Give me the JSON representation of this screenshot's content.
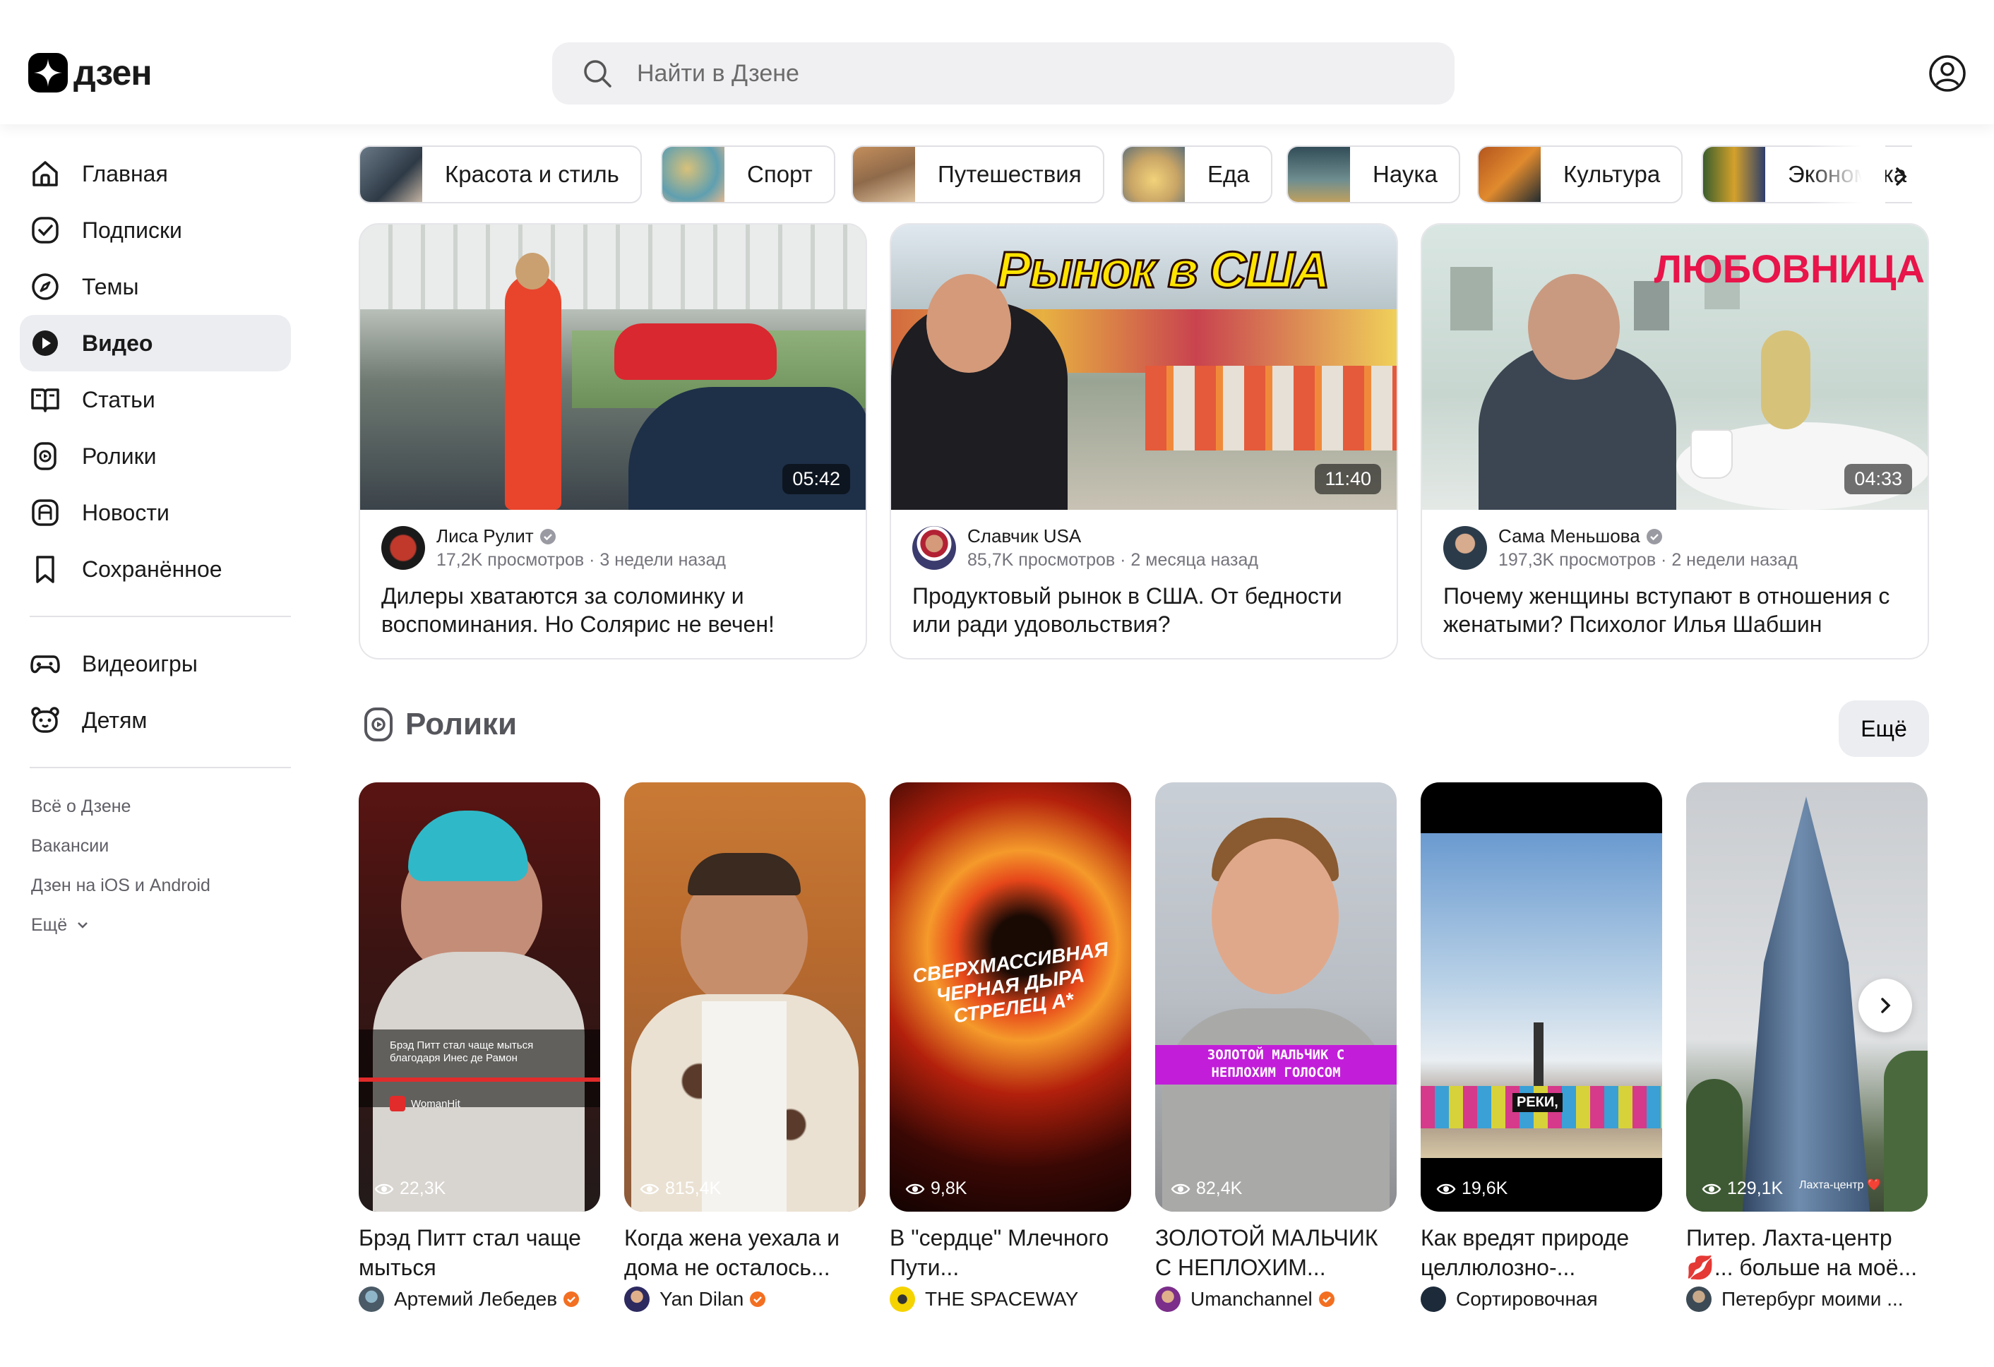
{
  "app": {
    "logo_text": "дзен"
  },
  "search": {
    "placeholder": "Найти в Дзене"
  },
  "sidebar": {
    "items": [
      {
        "label": "Главная",
        "icon": "home-icon"
      },
      {
        "label": "Подписки",
        "icon": "subscriptions-icon"
      },
      {
        "label": "Темы",
        "icon": "compass-icon"
      },
      {
        "label": "Видео",
        "icon": "video-icon",
        "active": true
      },
      {
        "label": "Статьи",
        "icon": "book-icon"
      },
      {
        "label": "Ролики",
        "icon": "shorts-icon"
      },
      {
        "label": "Новости",
        "icon": "news-icon"
      },
      {
        "label": "Сохранённое",
        "icon": "bookmark-icon"
      }
    ],
    "extra_items": [
      {
        "label": "Видеоигры",
        "icon": "gamepad-icon"
      },
      {
        "label": "Детям",
        "icon": "bear-icon"
      }
    ],
    "links": [
      "Всё о Дзене",
      "Вакансии",
      "Дзен на iOS и Android",
      "Ещё"
    ]
  },
  "chips": [
    "Красота и стиль",
    "Спорт",
    "Путешествия",
    "Еда",
    "Наука",
    "Культура",
    "Экономика"
  ],
  "videos": [
    {
      "duration": "05:42",
      "channel": "Лиса Рулит",
      "verified": true,
      "meta": "17,2K просмотров · 3 недели назад",
      "title": "Дилеры хватаются за соломинку и воспоминания. Но Солярис не вечен!"
    },
    {
      "duration": "11:40",
      "overlay": "Рынок в США",
      "channel": "Славчик USA",
      "verified": false,
      "meta": "85,7K просмотров · 2 месяца назад",
      "title": "Продуктовый рынок в США. От бедности или ради удовольствия?"
    },
    {
      "duration": "04:33",
      "overlay": "ЛЮБОВНИЦА",
      "channel": "Сама Меньшова",
      "verified": true,
      "meta": "197,3K просмотров · 2 недели назад",
      "title": "Почему женщины вступают в отношения с женатыми? Психолог Илья Шабшин"
    }
  ],
  "shorts_section": {
    "title": "Ролики",
    "more": "Ещё"
  },
  "shorts": [
    {
      "views": "22,3K",
      "title": "Брэд Питт стал чаще мыться",
      "author": "Артемий Лебедев",
      "badge": true,
      "caption": "Брэд Питт стал чаще мыться благодаря Инес де Рамон",
      "brand": "WomanHit"
    },
    {
      "views": "815,4K",
      "title": "Когда жена уехала и дома не осталось...",
      "author": "Yan Dilan",
      "badge": true
    },
    {
      "views": "9,8K",
      "title": "В \"сердце\" Млечного Пути...",
      "author": "THE SPACEWAY",
      "badge": false,
      "overlay": "СВЕРХМАССИВНАЯ ЧЕРНАЯ ДЫРА СТРЕЛЕЦ А*"
    },
    {
      "views": "82,4K",
      "title": "ЗОЛОТОЙ МАЛЬЧИК С НЕПЛОХИМ...",
      "author": "Umanchannel",
      "badge": true,
      "overlay": "ЗОЛОТОЙ МАЛЬЧИК С НЕПЛОХИМ ГОЛОСОМ"
    },
    {
      "views": "19,6K",
      "title": "Как вредят природе целлюлозно-...",
      "author": "Сортировочная",
      "badge": false,
      "overlay": "РЕКИ,"
    },
    {
      "views": "129,1K",
      "title": "Питер. Лахта-центр 💋... больше на моё...",
      "author": "Петербург моими ...",
      "badge": false,
      "overlay": "Лахта-центр ❤️"
    }
  ]
}
